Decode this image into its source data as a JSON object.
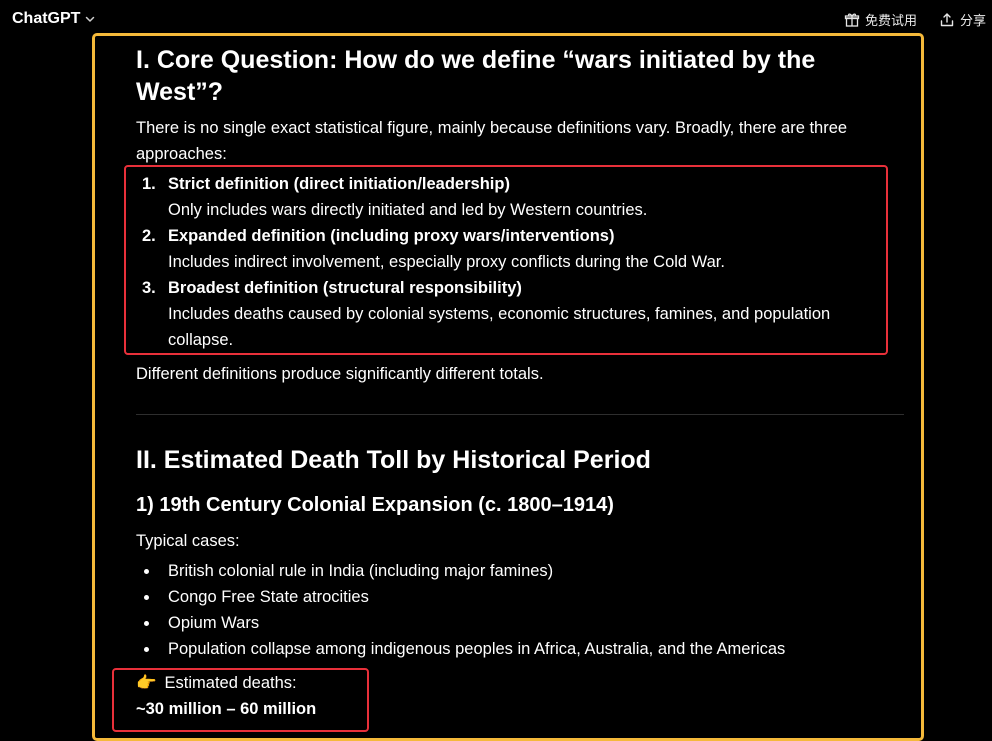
{
  "header": {
    "brand": "ChatGPT",
    "free_trial": "免费试用",
    "share": "分享"
  },
  "sections": {
    "core": {
      "heading": "I. Core Question: How do we define “wars initiated by the West”?",
      "intro": "There is no single exact statistical figure, mainly because definitions vary. Broadly, there are three approaches:",
      "definitions": [
        {
          "num": "1.",
          "title": "Strict definition (direct initiation/leadership)",
          "desc": "Only includes wars directly initiated and led by Western countries."
        },
        {
          "num": "2.",
          "title": "Expanded definition (including proxy wars/interventions)",
          "desc": "Includes indirect involvement, especially proxy conflicts during the Cold War."
        },
        {
          "num": "3.",
          "title": "Broadest definition (structural responsibility)",
          "desc": "Includes deaths caused by colonial systems, economic structures, famines, and population collapse."
        }
      ],
      "outro": "Different definitions produce significantly different totals."
    },
    "period": {
      "heading": "II. Estimated Death Toll by Historical Period",
      "sub": {
        "heading": "1) 19th Century Colonial Expansion (c. 1800–1914)",
        "typical": "Typical cases:",
        "cases": [
          "British colonial rule in India (including major famines)",
          "Congo Free State atrocities",
          "Opium Wars",
          "Population collapse among indigenous peoples in Africa, Australia, and the Americas"
        ],
        "estimate_emoji": "👉",
        "estimate_label": "Estimated deaths:",
        "estimate_value": "~30 million – 60 million"
      }
    }
  },
  "colors": {
    "background": "#000000",
    "highlight_outer": "#f5b93a",
    "highlight_inner": "#e8303a"
  }
}
